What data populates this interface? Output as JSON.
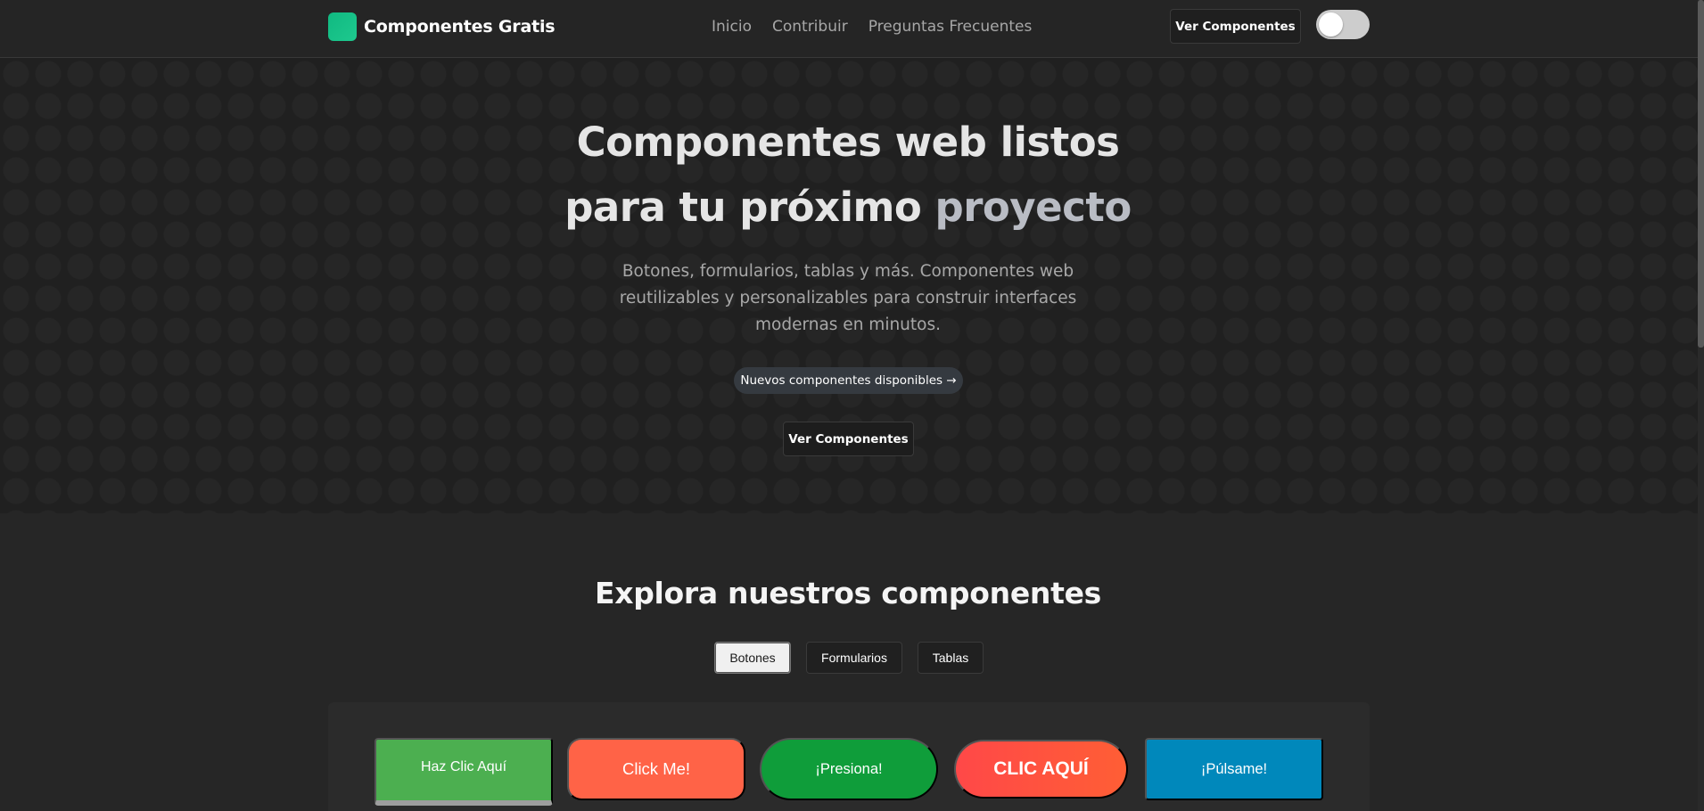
{
  "navbar": {
    "brand": "Componentes Gratis",
    "links": [
      "Inicio",
      "Contribuir",
      "Preguntas Frecuentes"
    ],
    "cta": "Ver Componentes",
    "theme_toggle_on": false
  },
  "hero": {
    "title_line1": "Componentes web listos",
    "title_line2_strong": "para tu próximo",
    "title_line2_accent": "proyecto",
    "subtitle": "Botones, formularios, tablas y más. Componentes web reutilizables y personalizables para construir interfaces modernas en minutos.",
    "badge": "Nuevos componentes disponibles →",
    "cta": "Ver Componentes"
  },
  "explore": {
    "title": "Explora nuestros componentes",
    "tabs": [
      "Botones",
      "Formularios",
      "Tablas"
    ],
    "active_tab": "Botones",
    "demo_buttons": [
      "Haz Clic Aquí",
      "Click Me!",
      "¡Presiona!",
      "CLIC AQUÍ",
      "¡Púlsame!"
    ]
  },
  "colors": {
    "brand_accent": "#10b981",
    "demo_green": "#4caf50",
    "demo_tomato": "#ff6347",
    "demo_dark_green": "#0f9d3a",
    "demo_red": "#ff4848",
    "demo_blue": "#0088bb"
  }
}
